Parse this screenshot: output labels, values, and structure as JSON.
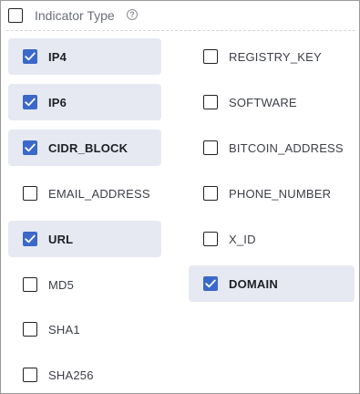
{
  "header": {
    "title": "Indicator Type",
    "help_icon": "?"
  },
  "accent_color": "#3b69c9",
  "selected_bg": "#e6e9f2",
  "left_column": [
    {
      "label": "IP4",
      "checked": true
    },
    {
      "label": "IP6",
      "checked": true
    },
    {
      "label": "CIDR_BLOCK",
      "checked": true
    },
    {
      "label": "EMAIL_ADDRESS",
      "checked": false
    },
    {
      "label": "URL",
      "checked": true
    },
    {
      "label": "MD5",
      "checked": false
    },
    {
      "label": "SHA1",
      "checked": false
    },
    {
      "label": "SHA256",
      "checked": false
    }
  ],
  "right_column": [
    {
      "label": "REGISTRY_KEY",
      "checked": false
    },
    {
      "label": "SOFTWARE",
      "checked": false
    },
    {
      "label": "BITCOIN_ADDRESS",
      "checked": false
    },
    {
      "label": "PHONE_NUMBER",
      "checked": false
    },
    {
      "label": "X_ID",
      "checked": false
    },
    {
      "label": "DOMAIN",
      "checked": true
    }
  ]
}
